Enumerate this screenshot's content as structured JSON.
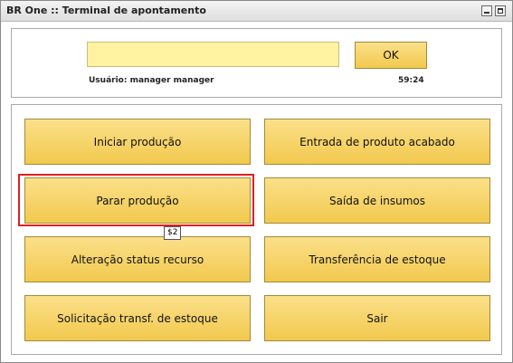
{
  "window": {
    "title": "BR One :: Terminal de apontamento"
  },
  "header": {
    "code_input_value": "",
    "ok_label": "OK",
    "user_label": "Usuário: manager manager",
    "timer": "59:24"
  },
  "actions": [
    {
      "label": "Iniciar produção"
    },
    {
      "label": "Entrada de produto acabado"
    },
    {
      "label": "Parar produção"
    },
    {
      "label": "Saída de insumos"
    },
    {
      "label": "Alteração status recurso"
    },
    {
      "label": "Transferência de estoque"
    },
    {
      "label": "Solicitação transf. de estoque"
    },
    {
      "label": "Sair"
    }
  ],
  "tooltip": "$2",
  "colors": {
    "button_fill": "#f6d36a",
    "input_fill": "#fff2a0",
    "highlight": "#e02020"
  }
}
